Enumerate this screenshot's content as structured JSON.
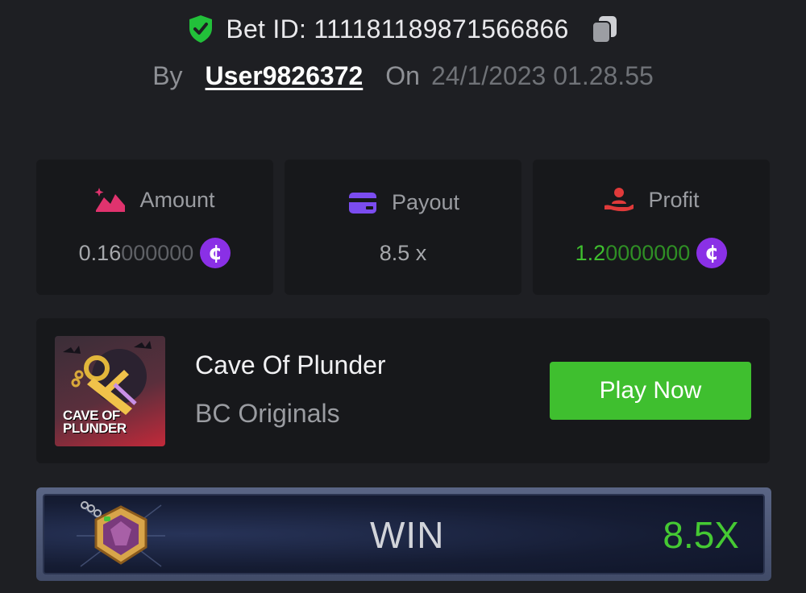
{
  "header": {
    "bet_id": "Bet ID: 111181189871566866",
    "by_label": "By",
    "username": "User9826372",
    "on_label": "On",
    "timestamp": "24/1/2023 01.28.55"
  },
  "stats": [
    {
      "icon": "amount-icon",
      "label": "Amount",
      "value_main": "0.16",
      "value_trail": "000000",
      "currency_icon": "coin-icon"
    },
    {
      "icon": "payout-icon",
      "label": "Payout",
      "value_main": "8.5 x"
    },
    {
      "icon": "profit-icon",
      "label": "Profit",
      "value_main": "1.2",
      "value_trail": "0000000",
      "currency_icon": "coin-icon"
    }
  ],
  "game": {
    "thumbnail_text": "CAVE OF PLUNDER",
    "title": "Cave Of Plunder",
    "provider": "BC Originals",
    "play_label": "Play Now"
  },
  "result": {
    "label": "WIN",
    "multiplier": "8.5X"
  },
  "colors": {
    "background": "#1e1f23",
    "card": "#17181b",
    "accent_green": "#3fbf2f",
    "coin_purple": "#8a30e6",
    "amount_pink": "#e0336e",
    "payout_purple": "#7b4cf0",
    "profit_red": "#e03a3a"
  }
}
